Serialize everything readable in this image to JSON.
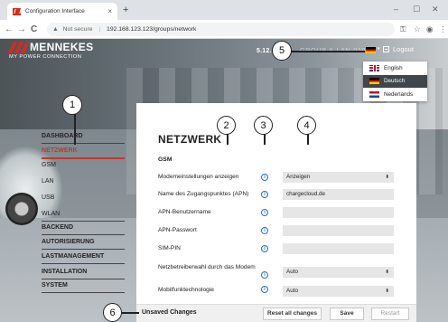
{
  "browser": {
    "tab_title": "Configuration Interface",
    "tab_close": "×",
    "new_tab": "+",
    "win_min": "–",
    "win_max": "☐",
    "win_close": "✕",
    "back": "←",
    "forward": "→",
    "reload": "C",
    "security_icon": "▲",
    "not_secure": "Not secure",
    "separator": "|",
    "url": "192.168.123.123/groups/network",
    "key_icon": "⚿",
    "star_icon": "☆",
    "account_icon": "◉",
    "menu_icon": "⋮"
  },
  "brand": {
    "name": "MENNEKES",
    "slogan": "MY POWER CONNECTION"
  },
  "header": {
    "ip_visible": "5.12.",
    "ip_ghost": "GROUP & LAN 010",
    "flag_caret": "▾",
    "logout_label": "Logout"
  },
  "language_menu": {
    "items": [
      {
        "label": "English",
        "selected": false
      },
      {
        "label": "Deutsch",
        "selected": true
      },
      {
        "label": "Nederlands",
        "selected": false
      }
    ]
  },
  "callouts": [
    "1",
    "2",
    "3",
    "4",
    "5",
    "6"
  ],
  "sidebar": {
    "items": [
      {
        "label": "DASHBOARD",
        "sub": false,
        "active": false
      },
      {
        "label": "NETZWERK",
        "sub": false,
        "active": true
      },
      {
        "label": "GSM",
        "sub": true,
        "active": false
      },
      {
        "label": "LAN",
        "sub": true,
        "active": false
      },
      {
        "label": "USB",
        "sub": true,
        "active": false
      },
      {
        "label": "WLAN",
        "sub": true,
        "active": false
      },
      {
        "label": "BACKEND",
        "sub": false,
        "active": false
      },
      {
        "label": "AUTORISIERUNG",
        "sub": false,
        "active": false
      },
      {
        "label": "LASTMANAGEMENT",
        "sub": false,
        "active": false
      },
      {
        "label": "INSTALLATION",
        "sub": false,
        "active": false
      },
      {
        "label": "SYSTEM",
        "sub": false,
        "active": false
      }
    ]
  },
  "content": {
    "title": "NETZWERK",
    "section": "GSM",
    "info_glyph": "i",
    "chevron": "⬍",
    "rows": [
      {
        "label": "Modemeinstellungen anzeigen",
        "value": "Anzeigen",
        "type": "select"
      },
      {
        "label": "Name des Zugangspunktes (APN)",
        "value": "chargecloud.de",
        "type": "text"
      },
      {
        "label": "APN-Benutzername",
        "value": "",
        "type": "text"
      },
      {
        "label": "APN-Passwort",
        "value": "",
        "type": "text"
      },
      {
        "label": "SIM-PIN",
        "value": "",
        "type": "text"
      },
      {
        "label": "Netzbetreiberwahl durch das Modem",
        "value": "Auto",
        "type": "select"
      },
      {
        "label": "Mobilfunktechnologie",
        "value": "Auto",
        "type": "select"
      }
    ]
  },
  "footer": {
    "unsaved": "Unsaved Changes",
    "reset_label": "Reset all changes",
    "save_label": "Save",
    "restart_label": "Restart"
  },
  "colors": {
    "accent_red": "#c0392b",
    "info_blue": "#2d6fbf"
  }
}
